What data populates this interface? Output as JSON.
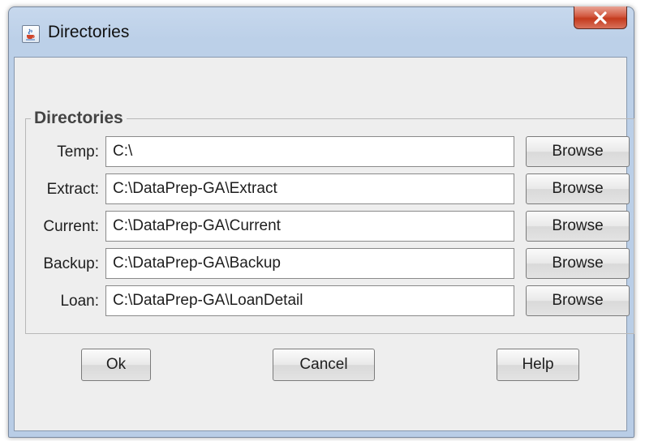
{
  "window": {
    "title": "Directories",
    "icon": "java-cup-icon",
    "close_label": "X"
  },
  "group": {
    "title": "Directories"
  },
  "rows": [
    {
      "label": "Temp:",
      "value": "C:\\",
      "browse_label": "Browse"
    },
    {
      "label": "Extract:",
      "value": "C:\\DataPrep-GA\\Extract",
      "browse_label": "Browse"
    },
    {
      "label": "Current:",
      "value": "C:\\DataPrep-GA\\Current",
      "browse_label": "Browse"
    },
    {
      "label": "Backup:",
      "value": "C:\\DataPrep-GA\\Backup",
      "browse_label": "Browse"
    },
    {
      "label": "Loan:",
      "value": "C:\\DataPrep-GA\\LoanDetail",
      "browse_label": "Browse"
    }
  ],
  "buttons": {
    "ok": "Ok",
    "cancel": "Cancel",
    "help": "Help"
  },
  "colors": {
    "title_bar": "#bcd0e8",
    "close_button": "#c43a1e",
    "client_background": "#eeeeee"
  }
}
